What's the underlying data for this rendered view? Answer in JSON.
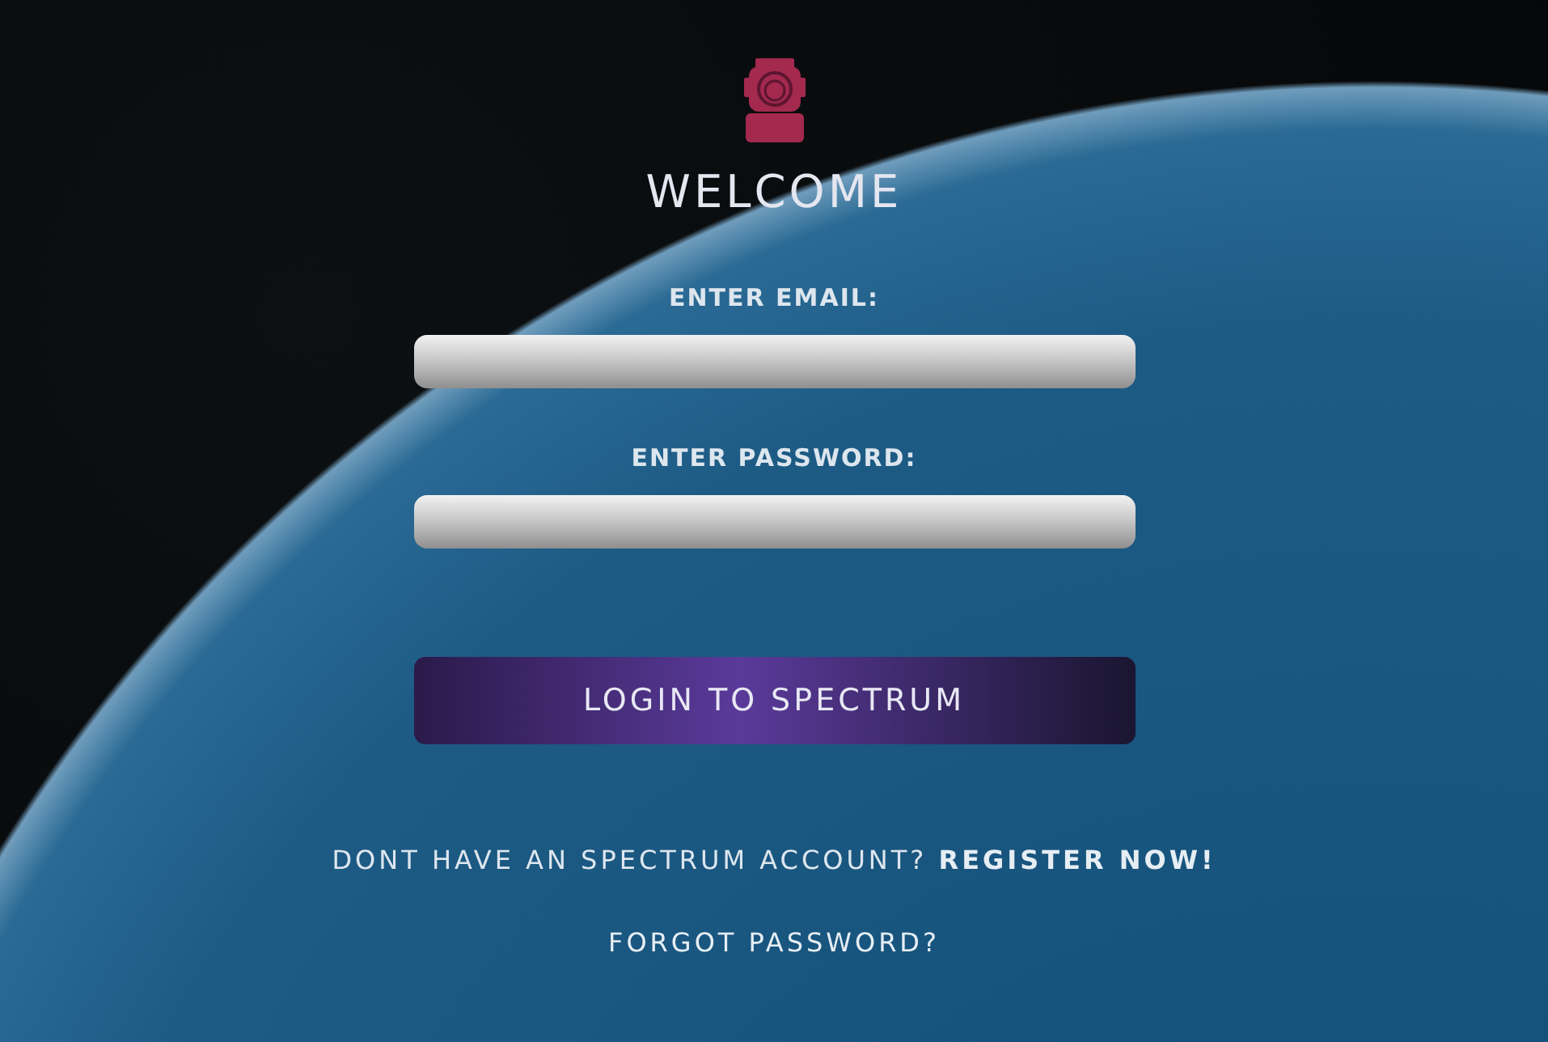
{
  "title": "WELCOME",
  "fields": [
    {
      "label": "ENTER EMAIL:"
    },
    {
      "label": "ENTER PASSWORD:"
    }
  ],
  "login_button": "LOGIN TO SPECTRUM",
  "register": {
    "text": "DONT HAVE AN SPECTRUM ACCOUNT?",
    "link": "REGISTER NOW!"
  },
  "forgot_link": "FORGOT PASSWORD?"
}
